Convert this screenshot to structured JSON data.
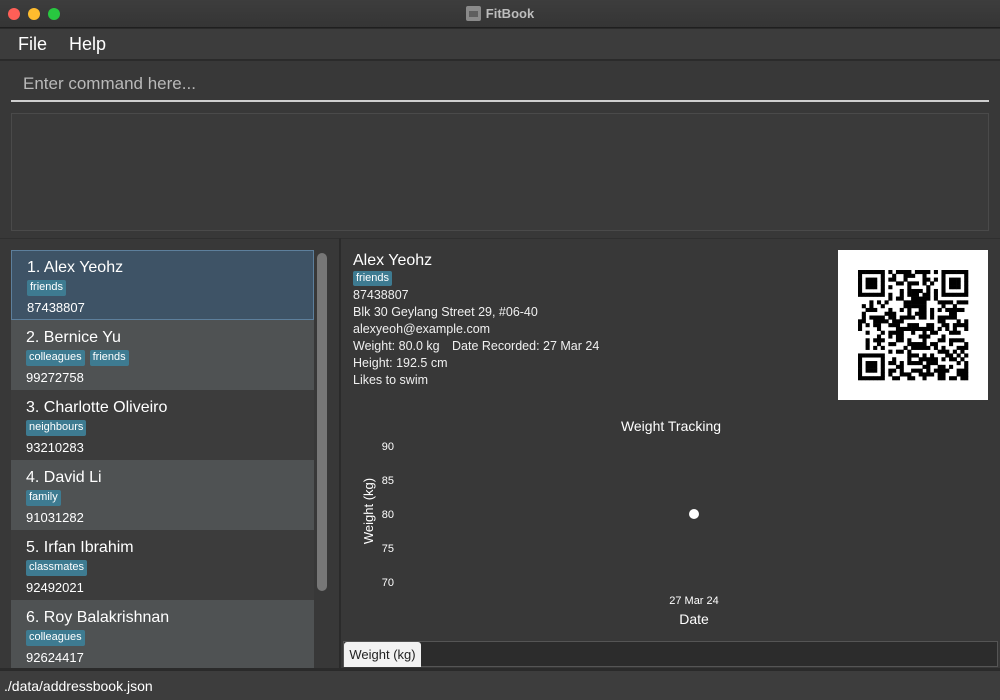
{
  "window": {
    "title": "FitBook"
  },
  "menu": {
    "file": "File",
    "help": "Help"
  },
  "command": {
    "placeholder": "Enter command here..."
  },
  "persons": [
    {
      "name": "1. Alex Yeohz",
      "tags": [
        "friends"
      ],
      "phone": "87438807"
    },
    {
      "name": "2. Bernice Yu",
      "tags": [
        "colleagues",
        "friends"
      ],
      "phone": "99272758"
    },
    {
      "name": "3. Charlotte Oliveiro",
      "tags": [
        "neighbours"
      ],
      "phone": "93210283"
    },
    {
      "name": "4. David Li",
      "tags": [
        "family"
      ],
      "phone": "91031282"
    },
    {
      "name": "5. Irfan Ibrahim",
      "tags": [
        "classmates"
      ],
      "phone": "92492021"
    },
    {
      "name": "6. Roy Balakrishnan",
      "tags": [
        "colleagues"
      ],
      "phone": "92624417"
    }
  ],
  "detail": {
    "name": "Alex Yeohz",
    "tag": "friends",
    "phone": "87438807",
    "address": "Blk 30 Geylang Street 29, #06-40",
    "email": "alexyeoh@example.com",
    "weight": "Weight: 80.0 kg",
    "date_recorded": "Date Recorded: 27 Mar 24",
    "height": "Height: 192.5 cm",
    "note": "Likes to swim"
  },
  "chart_data": {
    "type": "scatter",
    "title": "Weight Tracking",
    "xlabel": "Date",
    "ylabel": "Weight (kg)",
    "x": [
      "27 Mar 24"
    ],
    "y": [
      80
    ],
    "yticks": [
      90,
      85,
      80,
      75,
      70
    ],
    "ylim": [
      70,
      90
    ],
    "grid": false
  },
  "tabs": {
    "weight": "Weight (kg)"
  },
  "status": {
    "path": "./data/addressbook.json"
  }
}
